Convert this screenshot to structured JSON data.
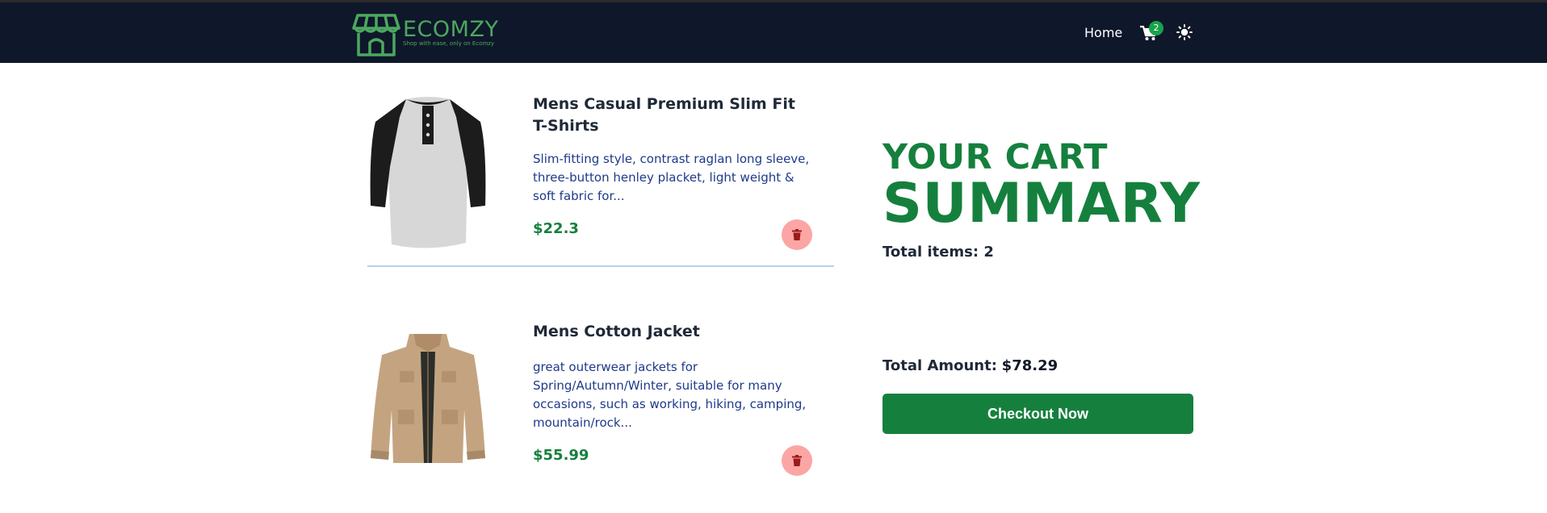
{
  "brand": {
    "name": "ECOMZY",
    "tagline": "Shop with ease, only on Ecomzy",
    "accent_color": "#4ca860"
  },
  "nav": {
    "home_label": "Home",
    "cart_count": "2",
    "cart_icon": "shopping-cart-icon",
    "theme_icon": "sun-icon"
  },
  "cart_items": [
    {
      "title": "Mens Casual Premium Slim Fit T-Shirts",
      "description": "Slim-fitting style, contrast raglan long sleeve, three-button henley placket, light weight & soft fabric for...",
      "price": "$22.3",
      "image_icon": "raglan-tshirt-image",
      "delete_icon": "trash-icon"
    },
    {
      "title": "Mens Cotton Jacket",
      "description": "great outerwear jackets for Spring/Autumn/Winter, suitable for many occasions, such as working, hiking, camping, mountain/rock...",
      "price": "$55.99",
      "image_icon": "cotton-jacket-image",
      "delete_icon": "trash-icon"
    }
  ],
  "summary": {
    "heading_line1": "YOUR CART",
    "heading_line2": "SUMMARY",
    "total_items": "Total items: 2",
    "total_amount_label": "Total Amount:",
    "total_amount_value": "$78.29",
    "checkout_label": "Checkout Now",
    "primary_color": "#15803d"
  }
}
